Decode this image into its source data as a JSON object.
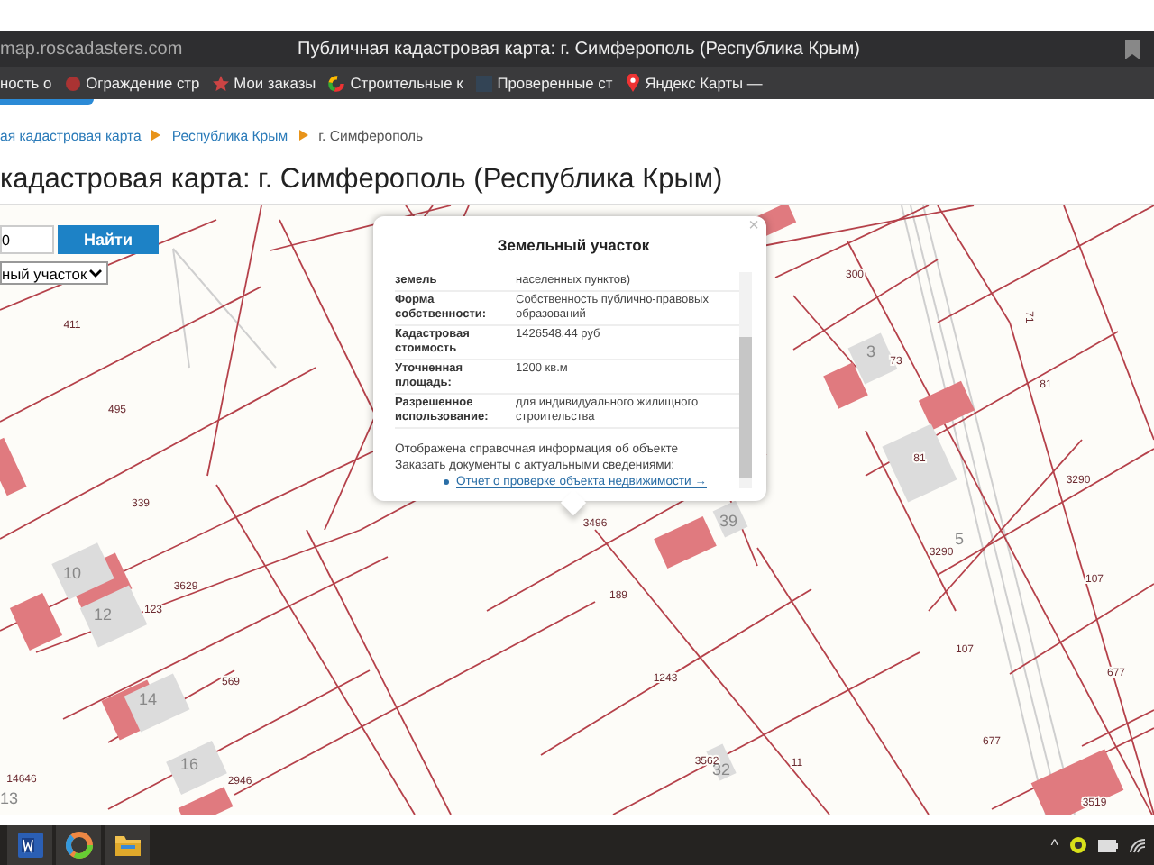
{
  "browser": {
    "url": "map.roscadasters.com",
    "title": "Публичная кадастровая карта: г. Симферополь (Республика Крым)",
    "bookmarks": [
      {
        "label": "ность о",
        "kind": "plain"
      },
      {
        "label": "Ограждение стр",
        "kind": "dot"
      },
      {
        "label": "Мои заказы",
        "kind": "star"
      },
      {
        "label": "Строительные к",
        "kind": "ring"
      },
      {
        "label": "Проверенные ст",
        "kind": "square"
      },
      {
        "label": "Яндекс Карты —",
        "kind": "pin"
      }
    ]
  },
  "breadcrumbs": [
    {
      "label": "ая кадастровая карта",
      "link": true
    },
    {
      "label": "Республика Крым",
      "link": true
    },
    {
      "label": "г. Симферополь",
      "link": false
    }
  ],
  "heading": "кадастровая карта: г. Симферополь (Республика Крым)",
  "search": {
    "value": "0",
    "button": "Найти",
    "type": "ный участок"
  },
  "map": {
    "labels": [
      {
        "text": "411",
        "kind": "parcel"
      },
      {
        "text": "495",
        "kind": "parcel"
      },
      {
        "text": "339",
        "kind": "parcel"
      },
      {
        "text": "3629",
        "kind": "parcel"
      },
      {
        "text": "123",
        "kind": "parcel"
      },
      {
        "text": "569",
        "kind": "parcel"
      },
      {
        "text": "2946",
        "kind": "parcel"
      },
      {
        "text": "14646",
        "kind": "parcel"
      },
      {
        "text": "10",
        "kind": "house"
      },
      {
        "text": "12",
        "kind": "house"
      },
      {
        "text": "14",
        "kind": "house"
      },
      {
        "text": "16",
        "kind": "house"
      },
      {
        "text": "13",
        "kind": "house"
      },
      {
        "text": "300",
        "kind": "parcel"
      },
      {
        "text": "71",
        "kind": "parcel"
      },
      {
        "text": "3",
        "kind": "house"
      },
      {
        "text": "73",
        "kind": "parcel"
      },
      {
        "text": "81",
        "kind": "parcel"
      },
      {
        "text": "81",
        "kind": "parcel"
      },
      {
        "text": "3290",
        "kind": "parcel"
      },
      {
        "text": "5",
        "kind": "house"
      },
      {
        "text": "3290",
        "kind": "parcel"
      },
      {
        "text": "107",
        "kind": "parcel"
      },
      {
        "text": "107",
        "kind": "parcel"
      },
      {
        "text": "677",
        "kind": "parcel"
      },
      {
        "text": "677",
        "kind": "parcel"
      },
      {
        "text": "3519",
        "kind": "parcel"
      },
      {
        "text": "3496",
        "kind": "parcel"
      },
      {
        "text": "39",
        "kind": "house"
      },
      {
        "text": "189",
        "kind": "parcel"
      },
      {
        "text": "1243",
        "kind": "parcel"
      },
      {
        "text": "3562",
        "kind": "parcel"
      },
      {
        "text": "32",
        "kind": "house"
      },
      {
        "text": "11",
        "kind": "parcel"
      }
    ]
  },
  "popup": {
    "title": "Земельный участок",
    "close": "×",
    "rows": [
      {
        "label": "земель",
        "value": "населенных пунктов)"
      },
      {
        "label": "Форма собственности:",
        "value": "Собственность публично-правовых образований"
      },
      {
        "label": "Кадастровая стоимость",
        "value": "1426548.44 руб"
      },
      {
        "label": "Уточненная площадь:",
        "value": "1200 кв.м"
      },
      {
        "label": "Разрешенное использование:",
        "value": "для индивидуального жилищного строительства"
      }
    ],
    "notes": [
      "Отображена справочная информация об объекте",
      "Заказать документы с актуальными сведениями:"
    ],
    "link": "Отчет о проверке объекта недвижимости →"
  },
  "taskbar": {
    "apps": [
      {
        "kind": "word"
      },
      {
        "kind": "browser"
      },
      {
        "kind": "folder"
      }
    ],
    "tray_caret": "^"
  }
}
